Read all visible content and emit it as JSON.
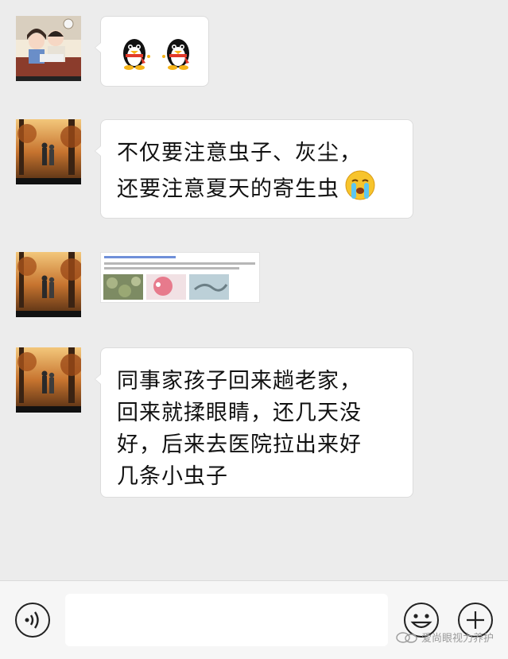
{
  "messages": [
    {
      "type": "sticker",
      "avatar": "couple-cartoon-avatar",
      "content": "two penguin stickers"
    },
    {
      "type": "text",
      "avatar": "autumn-forest-couple-avatar",
      "lines": [
        "不仅要注意虫子、灰尘，",
        "还要注意夏天的寄生虫"
      ],
      "emoji": "crying-face-emoji"
    },
    {
      "type": "image",
      "avatar": "autumn-forest-couple-avatar"
    },
    {
      "type": "text",
      "avatar": "autumn-forest-couple-avatar",
      "lines": [
        "同事家孩子回来趟老家，",
        "回来就揉眼睛，还几天没",
        "好，后来去医院拉出来好",
        "几条小虫子"
      ]
    }
  ],
  "input_bar": {
    "voice_icon": "voice-icon",
    "emoji_icon": "smile-icon",
    "add_icon": "plus-icon"
  },
  "watermark": {
    "text": "爱尚眼视力养护"
  },
  "colors": {
    "background": "#ececec",
    "bubble": "#ffffff",
    "bar": "#f6f6f6"
  }
}
